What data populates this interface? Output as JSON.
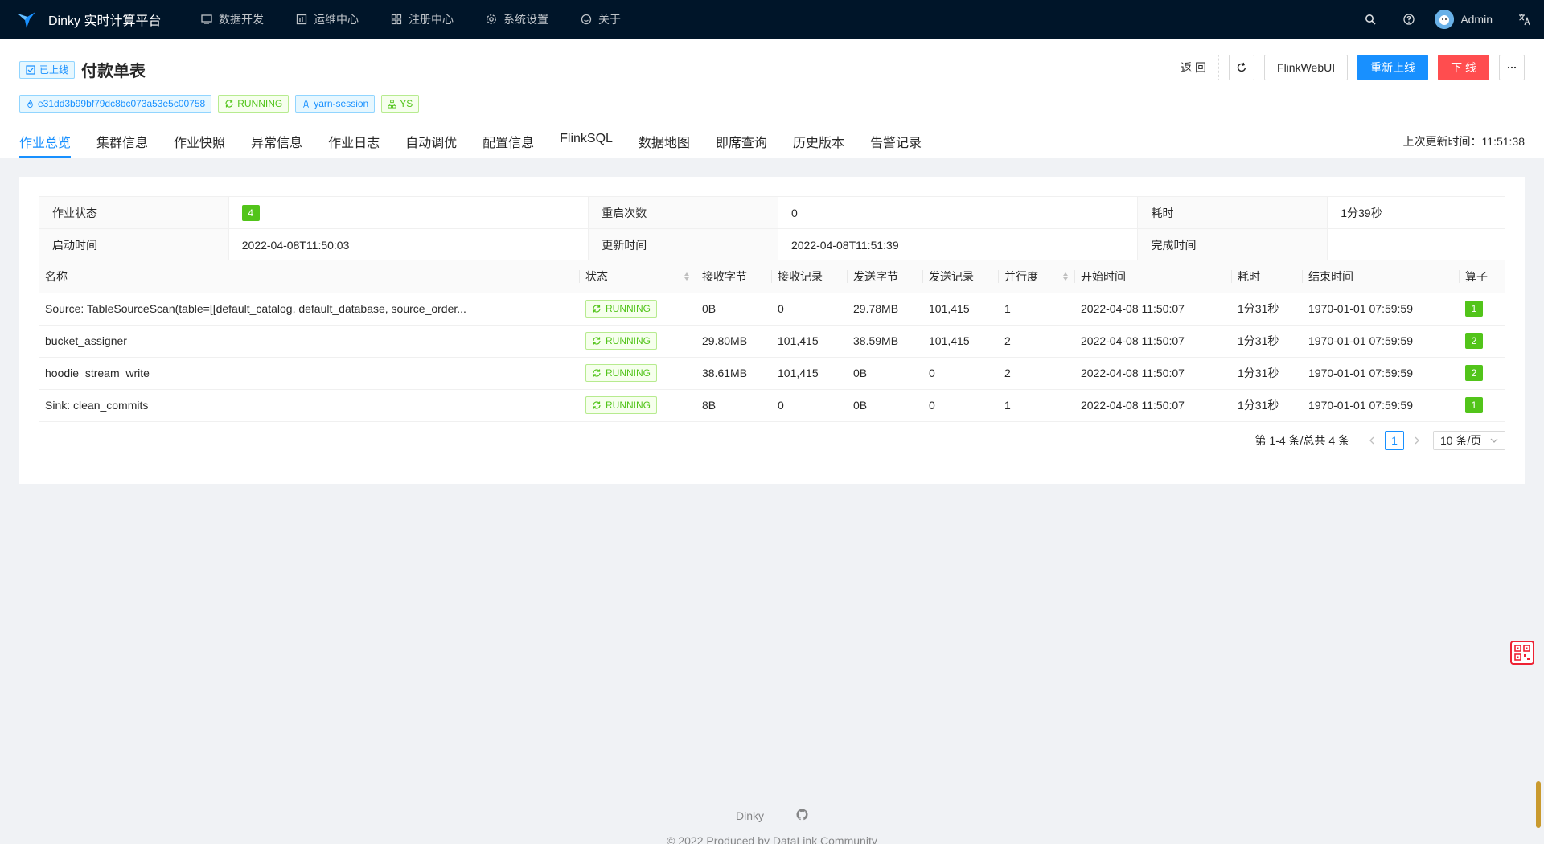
{
  "app": {
    "title": "Dinky 实时计算平台"
  },
  "nav": {
    "menu": [
      {
        "label": "数据开发",
        "icon": "monitor-icon"
      },
      {
        "label": "运维中心",
        "icon": "dashboard-icon"
      },
      {
        "label": "注册中心",
        "icon": "appstore-icon"
      },
      {
        "label": "系统设置",
        "icon": "gear-icon"
      },
      {
        "label": "关于",
        "icon": "smile-icon"
      }
    ],
    "user": "Admin"
  },
  "header": {
    "status_tag": "已上线",
    "title": "付款单表",
    "tags": [
      {
        "label": "e31dd3b99bf79dc8bc073a53e5c00758",
        "icon": "fire-icon",
        "color": "blue"
      },
      {
        "label": "RUNNING",
        "icon": "sync-icon",
        "color": "green"
      },
      {
        "label": "yarn-session",
        "icon": "rocket-icon",
        "color": "blue"
      },
      {
        "label": "YS",
        "icon": "cluster-icon",
        "color": "green"
      }
    ],
    "buttons": {
      "back": "返 回",
      "flink_web_ui": "FlinkWebUI",
      "republish": "重新上线",
      "offline": "下 线"
    },
    "tabs": [
      "作业总览",
      "集群信息",
      "作业快照",
      "异常信息",
      "作业日志",
      "自动调优",
      "配置信息",
      "FlinkSQL",
      "数据地图",
      "即席查询",
      "历史版本",
      "告警记录"
    ],
    "active_tab": 0,
    "last_update": "上次更新时间：11:51:38"
  },
  "overview": {
    "job_state_label": "作业状态",
    "job_state_value": "4",
    "restart_label": "重启次数",
    "restart_value": "0",
    "duration_label": "耗时",
    "duration_value": "1分39秒",
    "start_label": "启动时间",
    "start_value": "2022-04-08T11:50:03",
    "update_label": "更新时间",
    "update_value": "2022-04-08T11:51:39",
    "finish_label": "完成时间",
    "finish_value": ""
  },
  "table": {
    "columns": [
      "名称",
      "状态",
      "接收字节",
      "接收记录",
      "发送字节",
      "发送记录",
      "并行度",
      "开始时间",
      "耗时",
      "结束时间",
      "算子"
    ],
    "rows": [
      {
        "name": "Source: TableSourceScan(table=[[default_catalog, default_database, source_order...",
        "status": "RUNNING",
        "recv_bytes": "0B",
        "recv_records": "0",
        "send_bytes": "29.78MB",
        "send_records": "101,415",
        "parallelism": "1",
        "start": "2022-04-08 11:50:07",
        "duration": "1分31秒",
        "end": "1970-01-01 07:59:59",
        "ops": "1"
      },
      {
        "name": "bucket_assigner",
        "status": "RUNNING",
        "recv_bytes": "29.80MB",
        "recv_records": "101,415",
        "send_bytes": "38.59MB",
        "send_records": "101,415",
        "parallelism": "2",
        "start": "2022-04-08 11:50:07",
        "duration": "1分31秒",
        "end": "1970-01-01 07:59:59",
        "ops": "2"
      },
      {
        "name": "hoodie_stream_write",
        "status": "RUNNING",
        "recv_bytes": "38.61MB",
        "recv_records": "101,415",
        "send_bytes": "0B",
        "send_records": "0",
        "parallelism": "2",
        "start": "2022-04-08 11:50:07",
        "duration": "1分31秒",
        "end": "1970-01-01 07:59:59",
        "ops": "2"
      },
      {
        "name": "Sink: clean_commits",
        "status": "RUNNING",
        "recv_bytes": "8B",
        "recv_records": "0",
        "send_bytes": "0B",
        "send_records": "0",
        "parallelism": "1",
        "start": "2022-04-08 11:50:07",
        "duration": "1分31秒",
        "end": "1970-01-01 07:59:59",
        "ops": "1"
      }
    ]
  },
  "pagination": {
    "total": "第 1-4 条/总共 4 条",
    "current": "1",
    "page_size": "10 条/页"
  },
  "footer": {
    "link": "Dinky",
    "copyright": "© 2022 Produced by DataLink Community"
  },
  "colors": {
    "nav_bg": "#001529",
    "primary": "#1890ff",
    "danger": "#ff4d4f",
    "success": "#52c41a"
  }
}
